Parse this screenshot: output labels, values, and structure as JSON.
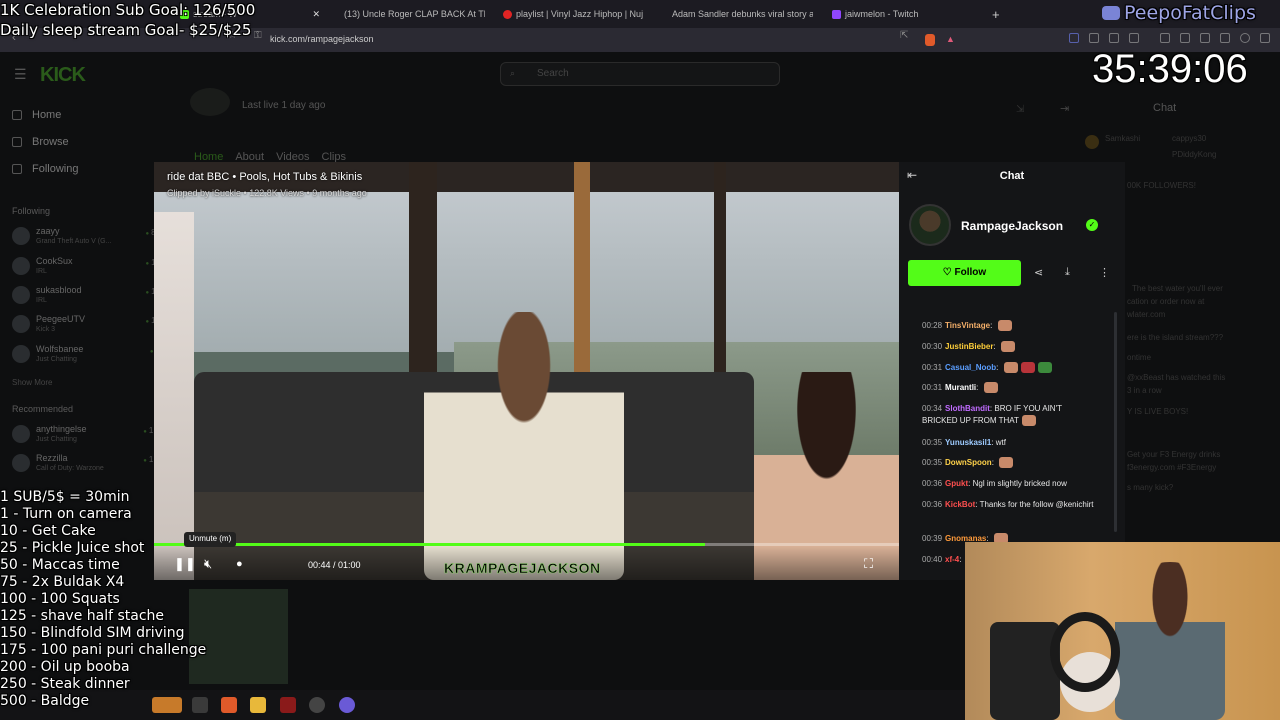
{
  "browser": {
    "tabs": [
      {
        "label": "stream - W",
        "color": "#53fc18"
      },
      {
        "label": "(13) Uncle Roger CLAP BACK At Thi",
        "color": "#e02424"
      },
      {
        "label": "playlist | Vinyl Jazz Hiphop | Nuj",
        "color": "#e02424"
      },
      {
        "label": "Adam Sandler debunks viral story ab",
        "color": "#555555"
      },
      {
        "label": "jaiwmelon - Twitch",
        "color": "#9146ff"
      }
    ],
    "url": "kick.com/rampagejackson"
  },
  "kick": {
    "logo": "KICK",
    "search_placeholder": "Search",
    "last_live": "Last live 1 day ago",
    "profile_tabs": [
      "Home",
      "About",
      "Videos",
      "Clips"
    ],
    "nav": [
      {
        "label": "Home",
        "icon": "home-icon"
      },
      {
        "label": "Browse",
        "icon": "browse-icon"
      },
      {
        "label": "Following",
        "icon": "heart-icon"
      }
    ],
    "following_header": "Following",
    "following": [
      {
        "name": "zaayy",
        "sub": "Grand Theft Auto V (G...",
        "count": "88"
      },
      {
        "name": "CookSux",
        "sub": "IRL",
        "count": "18"
      },
      {
        "name": "sukasblood",
        "sub": "IRL",
        "count": "13"
      },
      {
        "name": "PeegeeUTV",
        "sub": "Kick 3",
        "count": "17"
      },
      {
        "name": "Wolfsbanee",
        "sub": "Just Chatting",
        "count": "8"
      }
    ],
    "show_more": "Show More",
    "recommended_header": "Recommended",
    "recommended": [
      {
        "name": "anythingelse",
        "sub": "Just Chatting",
        "count": "1.2"
      },
      {
        "name": "Rezzilla",
        "sub": "Call of Duty: Warzone",
        "count": "1.1"
      }
    ],
    "right_chat_header": "Chat",
    "right_chat_bg": [
      "Samkashi",
      "cappys30",
      "PDiddyKong",
      "00K FOLLOWERS!",
      "The best water you'll ever",
      "cation or order now at",
      "wlater.com",
      "ere is the island stream???",
      "ontime",
      "@xxBeast has watched this",
      "3 in a row",
      "Y IS LIVE BOYS!",
      "Get your F3 Energy drinks",
      "f3energy.com #F3Energy",
      "s many kick?"
    ]
  },
  "video": {
    "title": "ride dat BBC • Pools, Hot Tubs & Bikinis",
    "subtitle": "Clipped by iSuckle • 122.8K Views • 9 months ago",
    "tooltip": "Unmute (m)",
    "time": "00:44 / 01:00",
    "progress": 0.74,
    "watermark": "KRAMPAGEJACKSON"
  },
  "chat": {
    "title": "Chat",
    "channel": "RampageJackson",
    "follow_label": "Follow",
    "messages": [
      {
        "time": "00:28",
        "user": "TinsVintage",
        "color": "#f5b06a",
        "text": "",
        "emotes": 1
      },
      {
        "time": "00:30",
        "user": "JustinBieber",
        "color": "#ffcf3a",
        "text": "",
        "emotes": 1
      },
      {
        "time": "00:31",
        "user": "Casual_Noob",
        "color": "#5b9eff",
        "text": "",
        "emotes": 3
      },
      {
        "time": "00:31",
        "user": "Murantli",
        "color": "#ffffff",
        "text": "",
        "emotes": 1
      },
      {
        "time": "00:34",
        "user": "SlothBandit",
        "color": "#c06bff",
        "text": "BRO IF YOU AIN'T BRICKED UP FROM THAT",
        "emotes": 1
      },
      {
        "time": "00:35",
        "user": "Yunuskasil1",
        "color": "#9ecbff",
        "text": "wtf",
        "emotes": 0
      },
      {
        "time": "00:35",
        "user": "DownSpoon",
        "color": "#ffd24a",
        "text": "",
        "emotes": 1
      },
      {
        "time": "00:36",
        "user": "Gpukt",
        "color": "#ff4f4f",
        "text": "Ngl im slightly bricked now",
        "emotes": 0
      },
      {
        "time": "00:36",
        "user": "KickBot",
        "color": "#ff4f4f",
        "text": "Thanks for the follow @kenichirt",
        "emotes": 0
      },
      {
        "time": "00:39",
        "user": "Gnomanas",
        "color": "#ff9a3a",
        "text": "",
        "emotes": 1
      },
      {
        "time": "00:40",
        "user": "xf-4",
        "color": "#ff4f4f",
        "text": "",
        "emotes": 0
      }
    ]
  },
  "overlay": {
    "goal_sub": "1K Celebration Sub Goal: 126/500",
    "goal_sleep": "Daily sleep stream Goal- $25/$25",
    "timer": "35:39:06",
    "brand": "PeepoFatClips",
    "menu": [
      "1 SUB/5$ = 30min",
      "1 - Turn on camera",
      "10 - Get Cake",
      "25 - Pickle Juice shot",
      "50 - Maccas time",
      "75 - 2x Buldak X4",
      "100 - 100 Squats",
      "125 - shave half stache",
      "150 - Blindfold SIM driving",
      "175 - 100 pani puri challenge",
      "200 - Oil up booba",
      "250 - Steak dinner",
      "500 - Baldge"
    ]
  },
  "colors": {
    "accent": "#53fc18",
    "background": "#0e0f10"
  }
}
